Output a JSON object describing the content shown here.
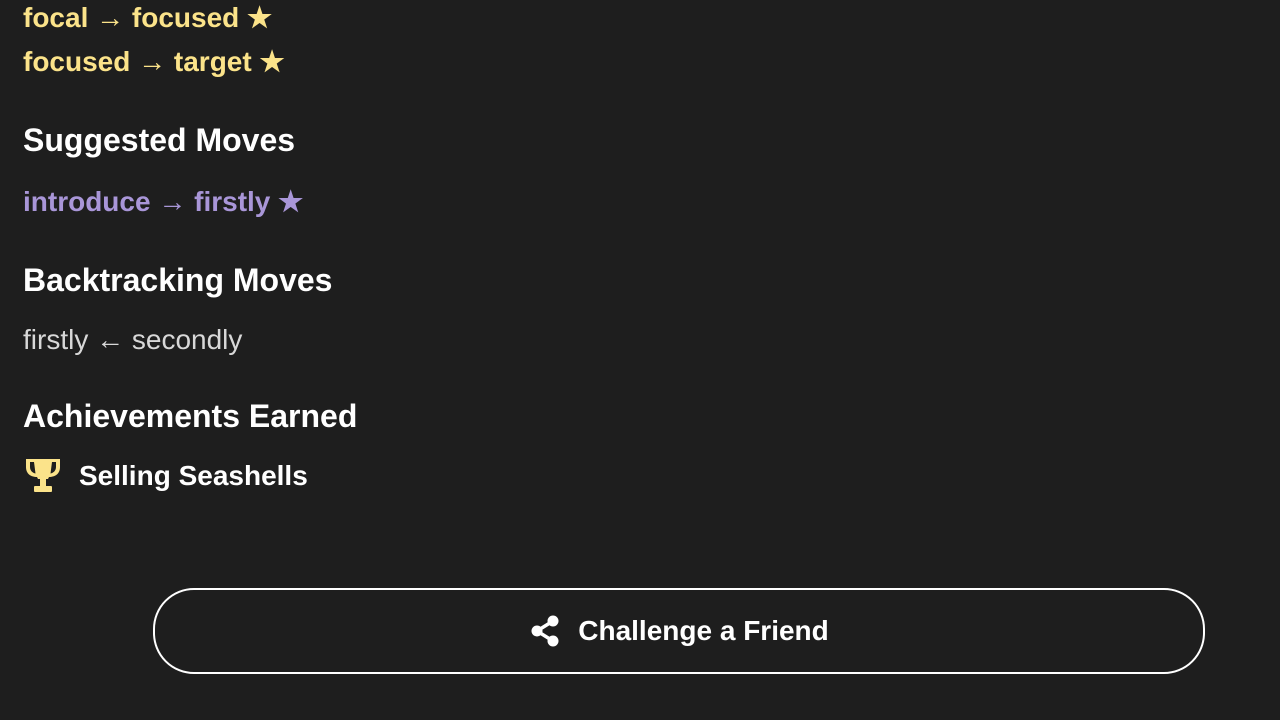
{
  "optimal_moves": [
    {
      "text": "focal → focused ★"
    },
    {
      "text": "focused → target ★"
    }
  ],
  "suggested": {
    "heading": "Suggested Moves",
    "moves": [
      {
        "text": "introduce → firstly ★"
      }
    ]
  },
  "backtracking": {
    "heading": "Backtracking Moves",
    "moves": [
      {
        "text": "firstly ← secondly"
      }
    ]
  },
  "achievements": {
    "heading": "Achievements Earned",
    "items": [
      {
        "label": "Selling Seashells",
        "icon": "trophy-icon"
      }
    ]
  },
  "challenge_button": {
    "label": "Challenge a Friend",
    "icon": "share-icon"
  },
  "colors": {
    "background": "#1e1e1e",
    "optimal": "#fbe38a",
    "suggested": "#a996d8",
    "backtrack": "#d8d8d8",
    "heading": "#ffffff",
    "trophy": "#fbe38a"
  }
}
